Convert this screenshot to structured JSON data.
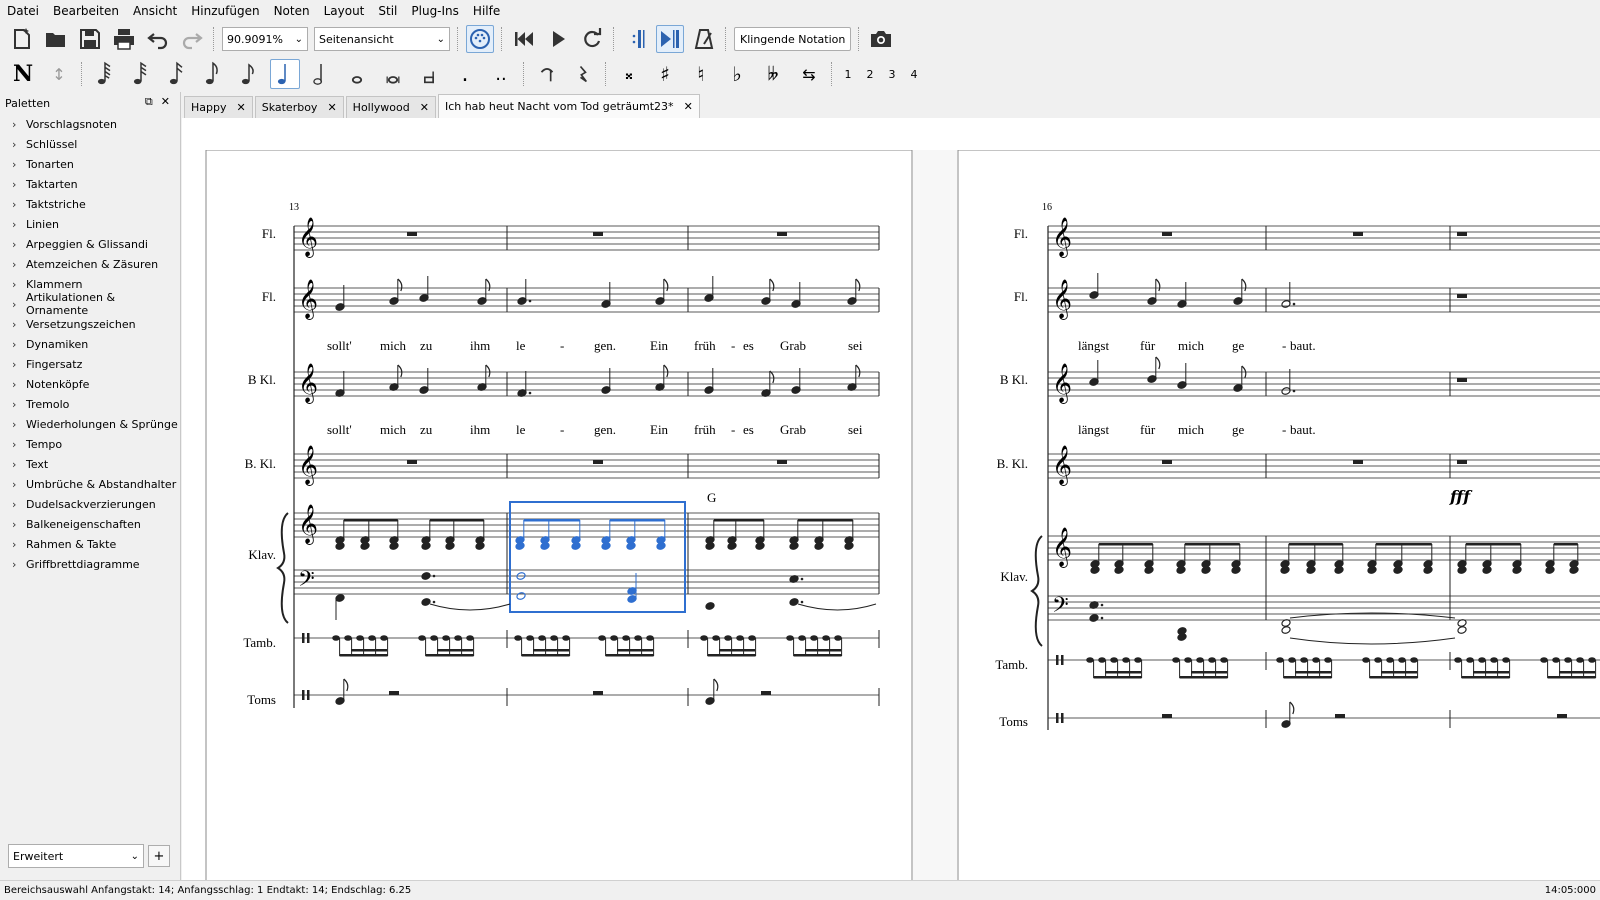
{
  "menu": [
    "Datei",
    "Bearbeiten",
    "Ansicht",
    "Hinzufügen",
    "Noten",
    "Layout",
    "Stil",
    "Plug-Ins",
    "Hilfe"
  ],
  "toolbar": {
    "zoom": "90.9091%",
    "view_mode": "Seitenansicht",
    "concert_pitch": "Klingende Notation",
    "icons": [
      "new-file-icon",
      "open-folder-icon",
      "save-icon",
      "print-icon",
      "undo-icon",
      "redo-icon",
      "midi-input-icon",
      "rewind-icon",
      "play-icon",
      "loop-icon",
      "loop-in-icon",
      "loop-out-icon",
      "metronome-icon",
      "camera-icon"
    ]
  },
  "note_input": {
    "voices": [
      "1",
      "2",
      "3",
      "4"
    ],
    "symbols": [
      "N",
      "↕",
      "𝅘𝅥𝅲",
      "𝅘𝅥𝅱",
      "𝅘𝅥𝅰",
      "𝅘𝅥𝅯",
      "♪",
      "♩",
      "𝅗𝅥",
      "𝅝",
      "𝅜",
      "𝅜.",
      ".",
      "..",
      "⌢",
      "𝄽",
      "𝄪",
      "♯",
      "♮",
      "♭",
      "𝄫",
      "⇆"
    ]
  },
  "palette": {
    "title": "Paletten",
    "items": [
      "Vorschlagsnoten",
      "Schlüssel",
      "Tonarten",
      "Taktarten",
      "Taktstriche",
      "Linien",
      "Arpeggien & Glissandi",
      "Atemzeichen & Zäsuren",
      "Klammern",
      "Artikulationen & Ornamente",
      "Versetzungszeichen",
      "Dynamiken",
      "Fingersatz",
      "Notenköpfe",
      "Tremolo",
      "Wiederholungen & Sprünge",
      "Tempo",
      "Text",
      "Umbrüche & Abstandhalter",
      "Dudelsackverzierungen",
      "Balkeneigenschaften",
      "Rahmen & Takte",
      "Griffbrettdiagramme"
    ],
    "workspace": "Erweitert",
    "add": "+"
  },
  "tabs": [
    {
      "label": "Happy",
      "active": false
    },
    {
      "label": "Skaterboy",
      "active": false
    },
    {
      "label": "Hollywood",
      "active": false
    },
    {
      "label": "Ich hab heut Nacht vom Tod geträumt23*",
      "active": true
    }
  ],
  "score": {
    "page1": {
      "measure_number": "13",
      "instruments": [
        "Fl.",
        "Fl.",
        "B Kl.",
        "B. Kl.",
        "Klav.",
        "Tamb.",
        "Toms"
      ],
      "lyrics_fl": [
        "sollt'",
        "mich",
        "zu",
        "ihm",
        "le",
        "-",
        "gen.",
        "Ein",
        "früh",
        "-",
        "es",
        "Grab",
        "sei"
      ],
      "lyrics_bkl": [
        "sollt'",
        "mich",
        "zu",
        "ihm",
        "le",
        "-",
        "gen.",
        "Ein",
        "früh",
        "-",
        "es",
        "Grab",
        "sei"
      ],
      "chord": "G"
    },
    "page2": {
      "measure_number": "16",
      "instruments": [
        "Fl.",
        "Fl.",
        "B Kl.",
        "B. Kl.",
        "Klav.",
        "Tamb.",
        "Toms"
      ],
      "lyrics_fl": [
        "längst",
        "für",
        "mich",
        "ge",
        "-",
        "baut."
      ],
      "lyrics_bkl": [
        "längst",
        "für",
        "mich",
        "ge",
        "-",
        "baut."
      ],
      "dynamic": "fff"
    }
  },
  "status": {
    "selection": "Bereichsauswahl Anfangstakt: 14; Anfangsschlag: 1 Endtakt: 14; Endschlag: 6.25",
    "time": "14:05:000"
  }
}
